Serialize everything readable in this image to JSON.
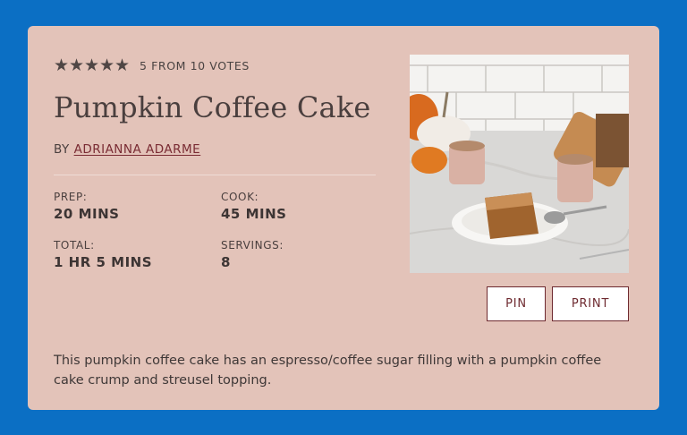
{
  "recipe": {
    "rating": {
      "stars": 5,
      "star_glyph": "★",
      "votes_text": "5 FROM 10 VOTES"
    },
    "title": "Pumpkin Coffee Cake",
    "byline_prefix": "BY",
    "author": "ADRIANNA ADARME",
    "meta": {
      "prep_label": "PREP:",
      "prep_value": "20 MINS",
      "cook_label": "COOK:",
      "cook_value": "45 MINS",
      "total_label": "TOTAL:",
      "total_value": "1 HR 5 MINS",
      "servings_label": "SERVINGS:",
      "servings_value": "8"
    },
    "buttons": {
      "pin": "PIN",
      "print": "PRINT"
    },
    "description": "This pumpkin coffee cake has an espresso/coffee sugar filling with a pumpkin coffee cake crump and streusel topping."
  },
  "colors": {
    "page_background": "#0b6fc4",
    "card_background": "#e3c3b9",
    "accent": "#6e2a30",
    "text": "#4a3f3e"
  }
}
